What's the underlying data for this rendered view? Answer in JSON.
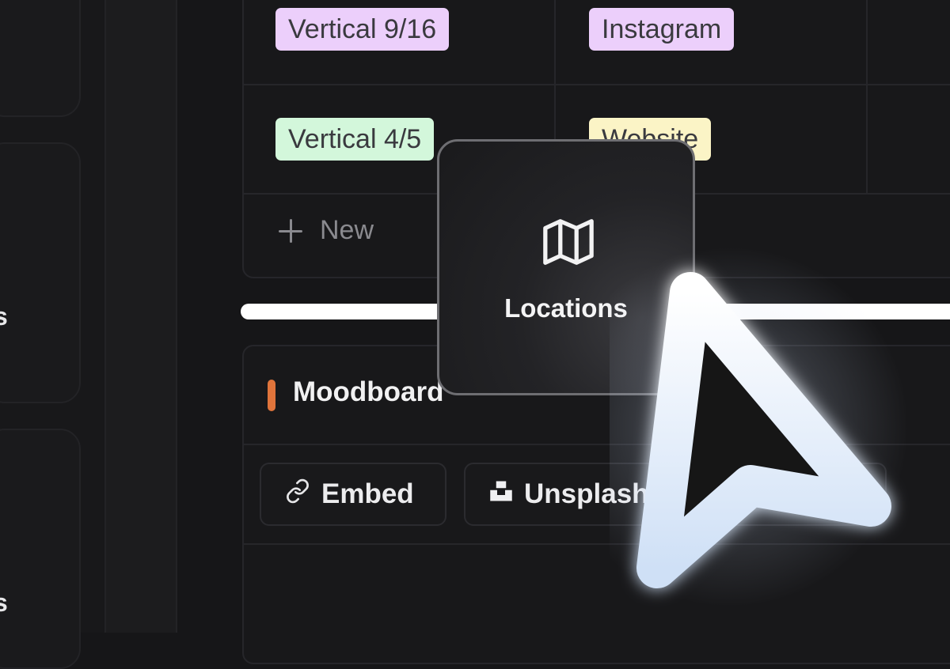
{
  "sidebar": {
    "fragments": [
      "s",
      "s"
    ]
  },
  "table": {
    "rows": [
      {
        "col1": "Vertical 9/16",
        "col2": "Instagram"
      },
      {
        "col1": "Vertical 4/5",
        "col2": "Website"
      }
    ],
    "new_label": "New"
  },
  "popover": {
    "label": "Locations",
    "icon": "map-icon"
  },
  "moodboard": {
    "title": "Moodboard",
    "accent_color": "#e0743b",
    "chips": [
      {
        "label": "Embed",
        "icon": "link-icon"
      },
      {
        "label": "Unsplash",
        "icon": "unsplash-icon"
      }
    ]
  },
  "colors": {
    "tag_purple": "#eccffb",
    "tag_green": "#d3f7db",
    "tag_yellow": "#fbf4c6",
    "background": "#161618"
  }
}
